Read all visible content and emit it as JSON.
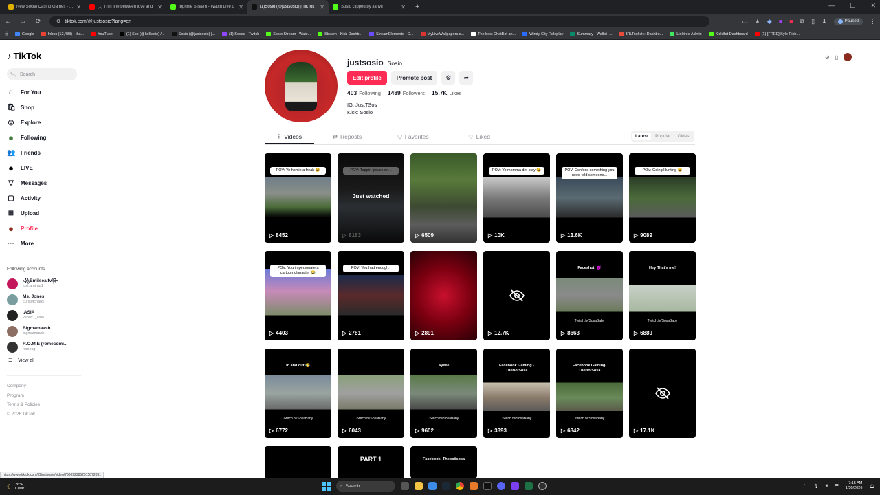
{
  "browser": {
    "tabs": [
      {
        "title": "New Social Casino Games - Pla",
        "color": "#e0b000"
      },
      {
        "title": "(1) Thin line between love and",
        "color": "#ff0000"
      },
      {
        "title": "Ibprime Stream - Watch Live o",
        "color": "#53fc18"
      },
      {
        "title": "(1)Sosio (@justsosio) | TikTok",
        "color": "#111111",
        "active": true
      },
      {
        "title": "Sosio clipped by Jahvii",
        "color": "#53fc18"
      }
    ],
    "url": "tiktok.com/@justsosio?lang=en",
    "paused_label": "Paused",
    "bookmarks": [
      {
        "label": "Google",
        "color": "#4285f4"
      },
      {
        "label": "Inbox (12,488) - tha...",
        "color": "#ea4335"
      },
      {
        "label": "YouTube",
        "color": "#ff0000"
      },
      {
        "label": "(1) Sos (@ItsSosio) /...",
        "color": "#000000"
      },
      {
        "label": "Sosio (@justsosio) |...",
        "color": "#111111"
      },
      {
        "label": "(1) Sosaa - Twitch",
        "color": "#9146ff"
      },
      {
        "label": "Sosio Stream - Watc...",
        "color": "#53fc18"
      },
      {
        "label": "Stream - Kick Dashb...",
        "color": "#53fc18"
      },
      {
        "label": "StreamElements - O...",
        "color": "#6b4cff"
      },
      {
        "label": "MyLiveWallpapers.c...",
        "color": "#d33"
      },
      {
        "label": "The best ChatBot an...",
        "color": "#ffffff"
      },
      {
        "label": "Windy City Roleplay",
        "color": "#2b6cff"
      },
      {
        "label": "Summary - Wallet -...",
        "color": "#0a8a6a"
      },
      {
        "label": "IRLToolkit » Dashbo...",
        "color": "#e94b3c"
      },
      {
        "label": "Linktree Admin",
        "color": "#43e660"
      },
      {
        "label": "KickBot Dashboard",
        "color": "#53fc18"
      },
      {
        "label": "(1) [FREE] Kyle Rich...",
        "color": "#ff0000"
      }
    ]
  },
  "sidebar": {
    "logo": "TikTok",
    "search_placeholder": "Search",
    "nav": [
      {
        "label": "For You",
        "icon": "home-icon",
        "glyph": "⌂"
      },
      {
        "label": "Shop",
        "icon": "shop-icon",
        "glyph": "🛍"
      },
      {
        "label": "Explore",
        "icon": "compass-icon",
        "glyph": "◎"
      },
      {
        "label": "Following",
        "icon": "following-avatar-icon",
        "glyph": "●"
      },
      {
        "label": "Friends",
        "icon": "friends-icon",
        "glyph": "👥"
      },
      {
        "label": "LIVE",
        "icon": "live-icon",
        "glyph": "●"
      },
      {
        "label": "Messages",
        "icon": "messages-icon",
        "glyph": "▽"
      },
      {
        "label": "Activity",
        "icon": "activity-icon",
        "glyph": "▢"
      },
      {
        "label": "Upload",
        "icon": "upload-icon",
        "glyph": "⊞"
      },
      {
        "label": "Profile",
        "icon": "profile-avatar-icon",
        "glyph": "●",
        "active": true
      },
      {
        "label": "More",
        "icon": "more-icon",
        "glyph": "···"
      }
    ],
    "following_header": "Following accounts",
    "accounts": [
      {
        "name": "꧁Emilsea.fv꧂",
        "handle": "just.amiraa1",
        "color": "#c2185b"
      },
      {
        "name": "Ms. Jones",
        "handle": "curlsofchaos",
        "color": "#7a9e9f"
      },
      {
        "name": ".ASIA",
        "handle": "2shox1_asia",
        "color": "#222222"
      },
      {
        "name": "Bigmamaash",
        "handle": "bigmamaash",
        "color": "#8d6e63"
      },
      {
        "name": "R.O.M.E (romecomi...",
        "handle": "romecg",
        "color": "#333333"
      }
    ],
    "view_all": "View all",
    "footer": [
      "Company",
      "Program",
      "Terms & Policies",
      "© 2026 TikTok"
    ]
  },
  "profile": {
    "username": "justsosio",
    "nickname": "Sosio",
    "edit_label": "Edit profile",
    "promote_label": "Promote post",
    "stats": [
      {
        "value": "403",
        "label": "Following"
      },
      {
        "value": "1489",
        "label": "Followers"
      },
      {
        "value": "15.7K",
        "label": "Likes"
      }
    ],
    "bio": [
      "IG: JustTSos",
      "Kick: Sosio"
    ]
  },
  "tabs": [
    {
      "label": "Videos",
      "icon": "grid-icon",
      "active": true
    },
    {
      "label": "Reposts",
      "icon": "repost-icon"
    },
    {
      "label": "Favorites",
      "icon": "bookmark-icon"
    },
    {
      "label": "Liked",
      "icon": "heart-icon"
    }
  ],
  "sort": [
    {
      "label": "Latest",
      "active": true
    },
    {
      "label": "Popular"
    },
    {
      "label": "Oldest"
    }
  ],
  "videos": [
    {
      "views": "8452",
      "caption": "POV: Yo homie a freak 😂",
      "scene": "street"
    },
    {
      "views": "8183",
      "caption": "POV: Tappin gloves on...",
      "scene": "dark",
      "overlay": "Just watched"
    },
    {
      "views": "6509",
      "caption": "",
      "scene": "bushes"
    },
    {
      "views": "10K",
      "caption": "POV: Yo momma dnt play 😂",
      "scene": "room"
    },
    {
      "views": "13.6K",
      "caption": "POV: Confess something you need told someone...",
      "scene": "night"
    },
    {
      "views": "9089",
      "caption": "POV: Going Hunting 😂",
      "scene": "forest"
    },
    {
      "views": "4403",
      "caption": "POV: You impersonate a cartoon character 😂",
      "scene": "pink"
    },
    {
      "views": "2781",
      "caption": "POV: You had enough..",
      "scene": "citynight"
    },
    {
      "views": "2891",
      "caption": "",
      "scene": "red"
    },
    {
      "views": "12.7K",
      "caption": "",
      "scene": "hidden"
    },
    {
      "views": "8663",
      "caption": "Faceshot! 😈",
      "scene": "road",
      "watermark": "Twitch.tv/SosaBaby"
    },
    {
      "views": "6889",
      "caption": "Hey That's me!",
      "scene": "car",
      "watermark": "Twitch.tv/SosaBaby"
    },
    {
      "views": "6772",
      "caption": "In and out 😂",
      "scene": "road2",
      "watermark": "Twitch.tv/SosaBaby"
    },
    {
      "views": "6043",
      "caption": "",
      "scene": "yellow",
      "watermark": "Twitch.tv/SosaBaby"
    },
    {
      "views": "9602",
      "caption": "Ayeee",
      "scene": "moto",
      "watermark": "Twitch.tv/SosaBaby"
    },
    {
      "views": "3393",
      "caption": "Facebook Gaming - TheBoiSosa",
      "scene": "interior",
      "watermark": "Twitch.tv/SosaBaby"
    },
    {
      "views": "6342",
      "caption": "Facebook Gaming- TheBoiSosa",
      "scene": "park",
      "watermark": "Twitch.tv/SosaBaby"
    },
    {
      "views": "17.1K",
      "caption": "",
      "scene": "hidden"
    },
    {
      "views": "",
      "caption": "",
      "scene": "partial"
    },
    {
      "views": "",
      "caption": "PART 1",
      "scene": "partial"
    },
    {
      "views": "",
      "caption": "Facebook: Theboiisosa",
      "scene": "partial"
    }
  ],
  "status_url": "https://www.tiktok.com/@justsosio/video/7600923852515872031",
  "taskbar": {
    "temp": "26°F",
    "condition": "Clear",
    "search": "Search",
    "time": "7:15 AM",
    "date": "1/30/2026"
  }
}
